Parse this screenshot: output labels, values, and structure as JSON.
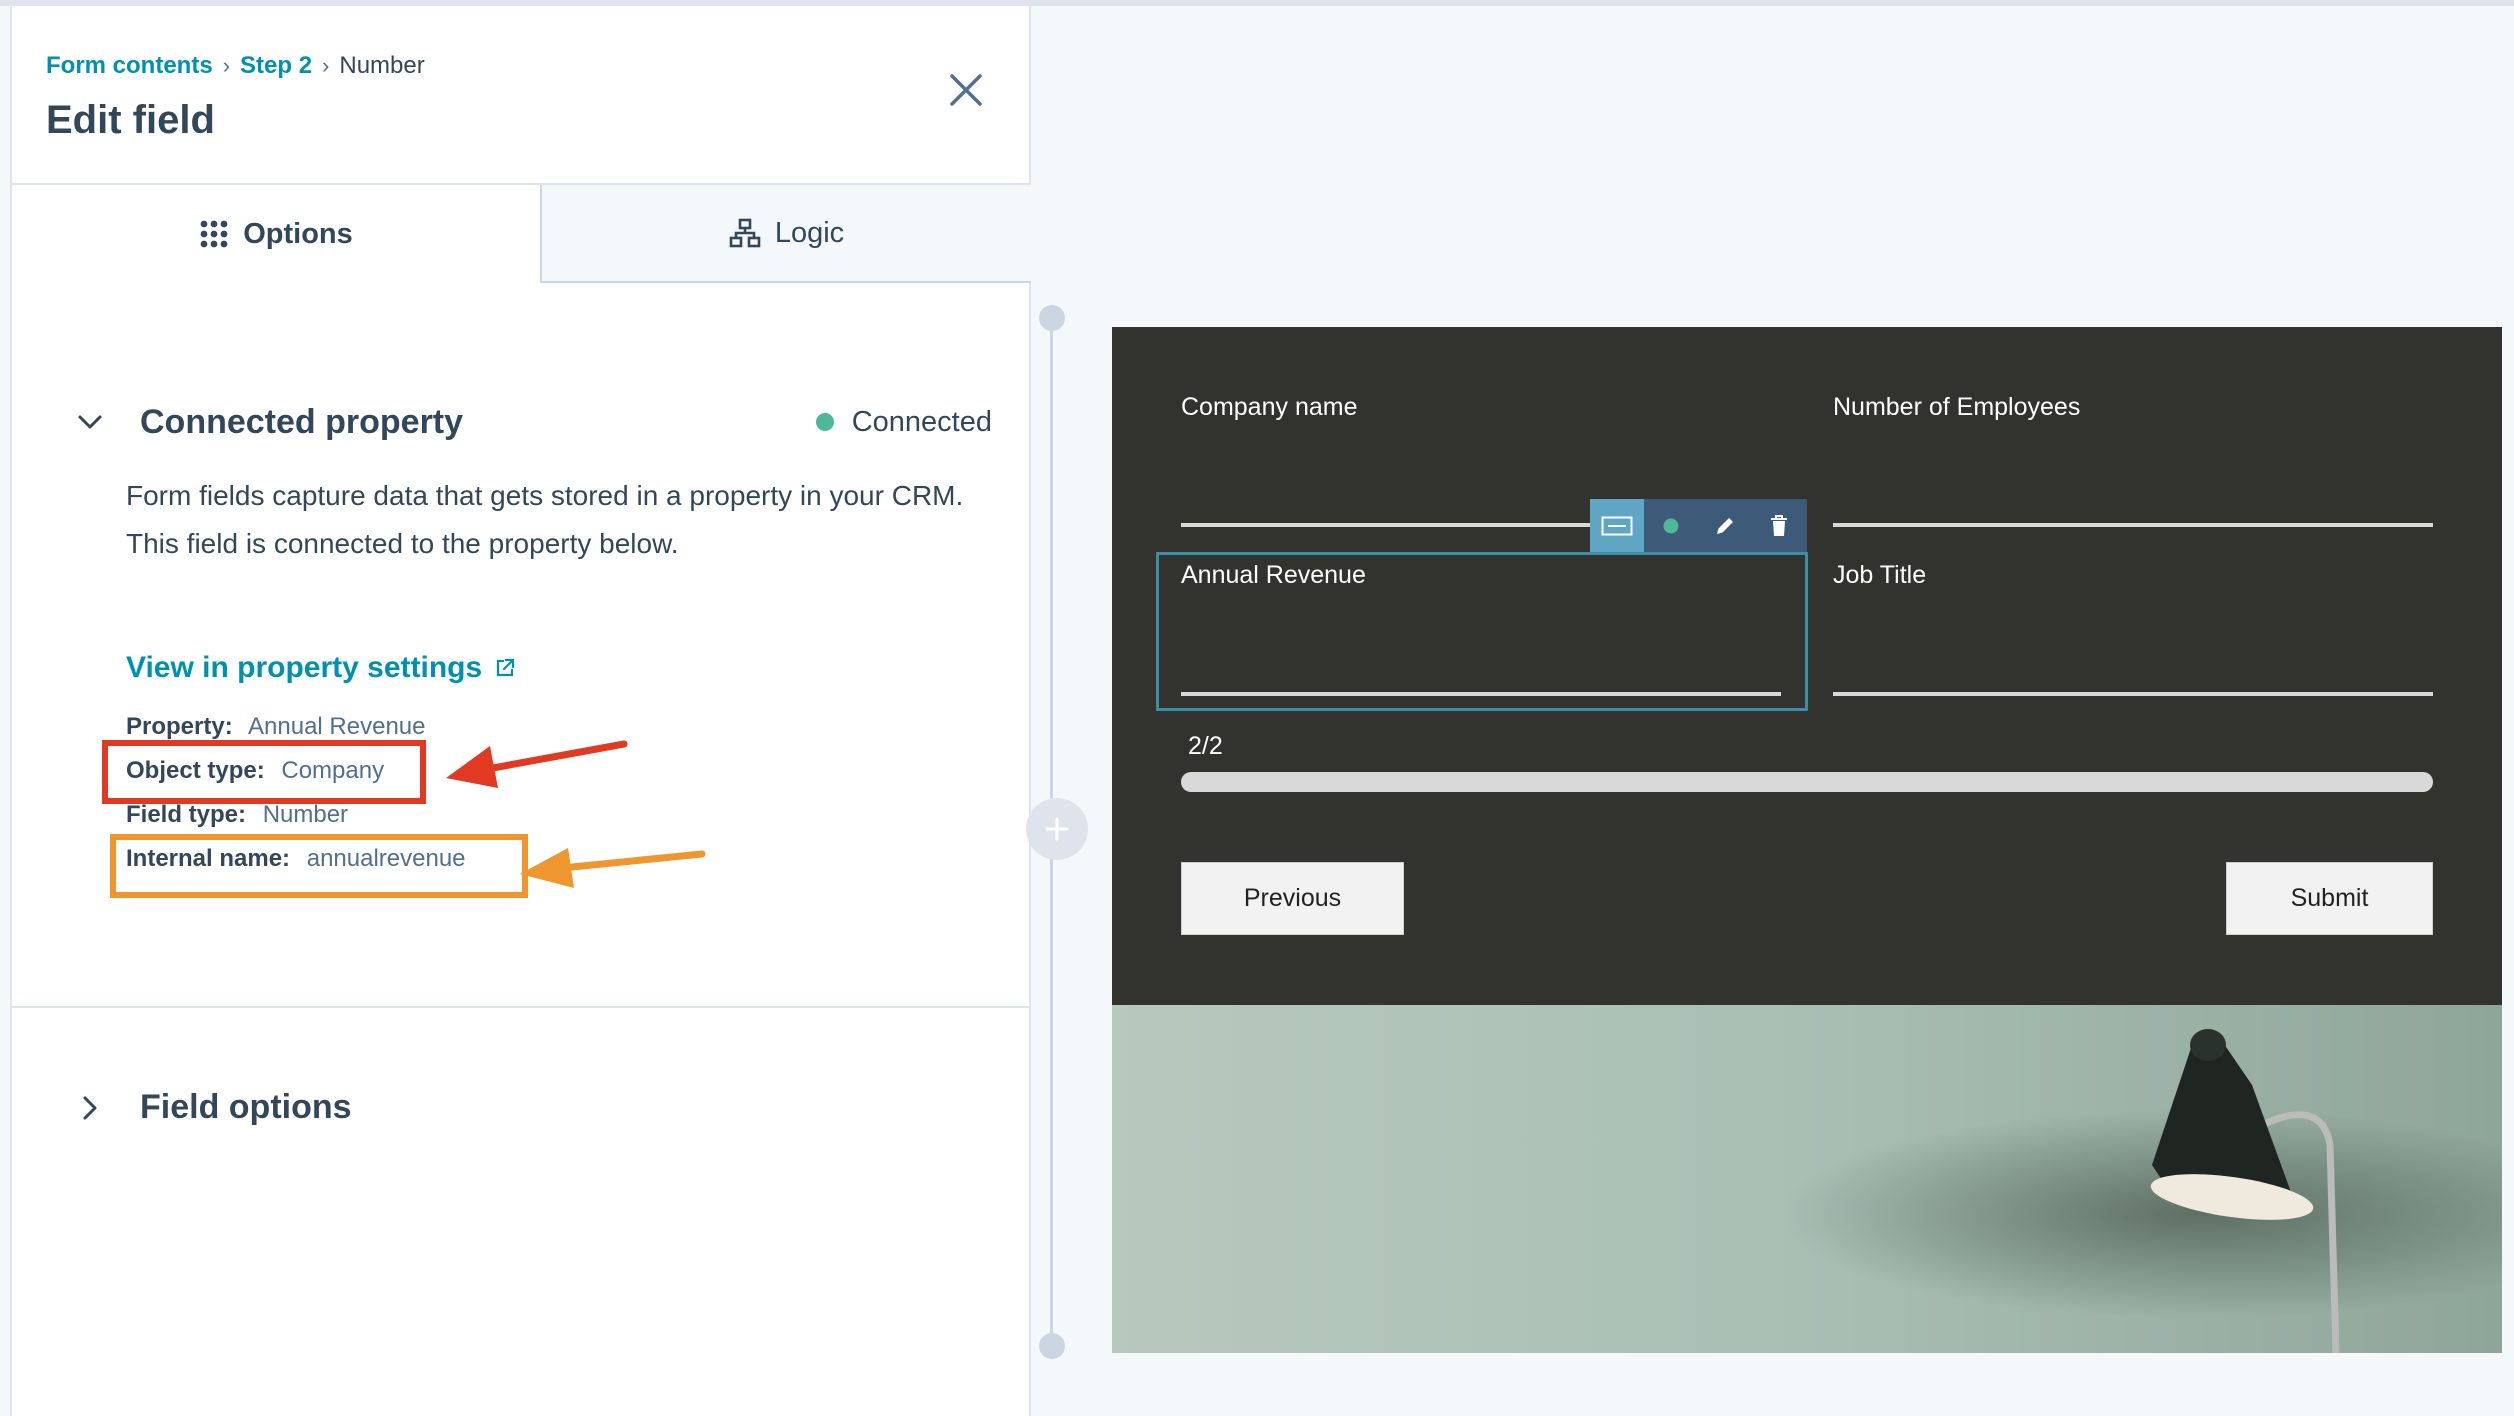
{
  "breadcrumb": {
    "items": [
      "Form contents",
      "Step 2"
    ],
    "current": "Number"
  },
  "panel": {
    "title": "Edit field"
  },
  "tabs": {
    "options": "Options",
    "logic": "Logic"
  },
  "connected_property": {
    "title": "Connected property",
    "status": "Connected",
    "description_1": "Form fields capture data that gets stored in a property in your CRM.",
    "description_2": "This field is connected to the property below.",
    "link": "View in property settings",
    "details": {
      "property_label": "Property:",
      "property_value": "Annual Revenue",
      "object_type_label": "Object type:",
      "object_type_value": "Company",
      "field_type_label": "Field type:",
      "field_type_value": "Number",
      "internal_name_label": "Internal name:",
      "internal_name_value": "annualrevenue"
    }
  },
  "field_options": {
    "title": "Field options"
  },
  "form_preview": {
    "fields": [
      "Company name",
      "Number of Employees",
      "Annual Revenue",
      "Job Title"
    ],
    "progress_text": "2/2",
    "progress": 1.0,
    "previous_label": "Previous",
    "submit_label": "Submit"
  },
  "colors": {
    "accent": "#0091ae",
    "connected": "#4fb89a",
    "highlight_red": "#e03a23",
    "highlight_orange": "#f0962e",
    "form_bg": "#32332e"
  },
  "icons": [
    "close-icon",
    "grid-dots-icon",
    "logic-branch-icon",
    "chevron-down-icon",
    "external-link-icon",
    "chevron-right-icon",
    "keyboard-icon",
    "dot-icon",
    "pencil-icon",
    "trash-icon",
    "plus-icon"
  ]
}
